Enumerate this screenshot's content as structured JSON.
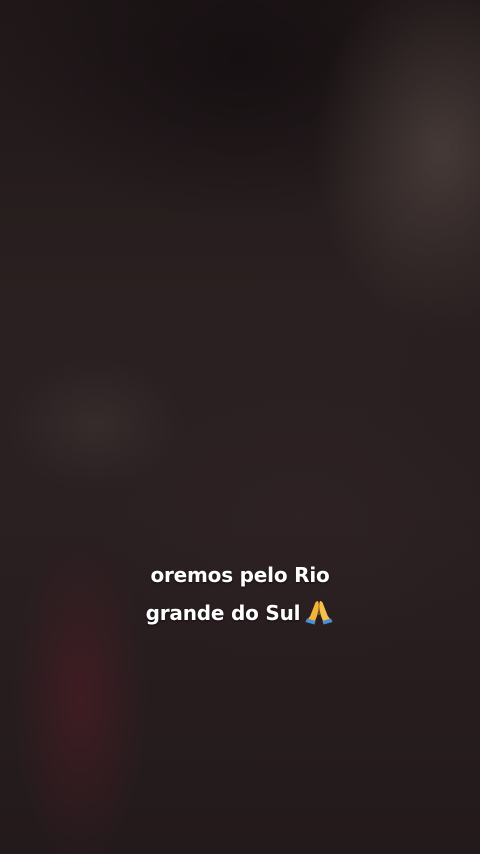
{
  "caption": {
    "line1": "oremos pelo Rio",
    "line2": "grande do Sul",
    "emoji_icon": "folded-hands-icon"
  },
  "colors": {
    "background": "#241b1c",
    "caption_text": "#ffffff",
    "emoji_hands": "#f4b43a",
    "emoji_sleeves": "#4a90d9"
  }
}
